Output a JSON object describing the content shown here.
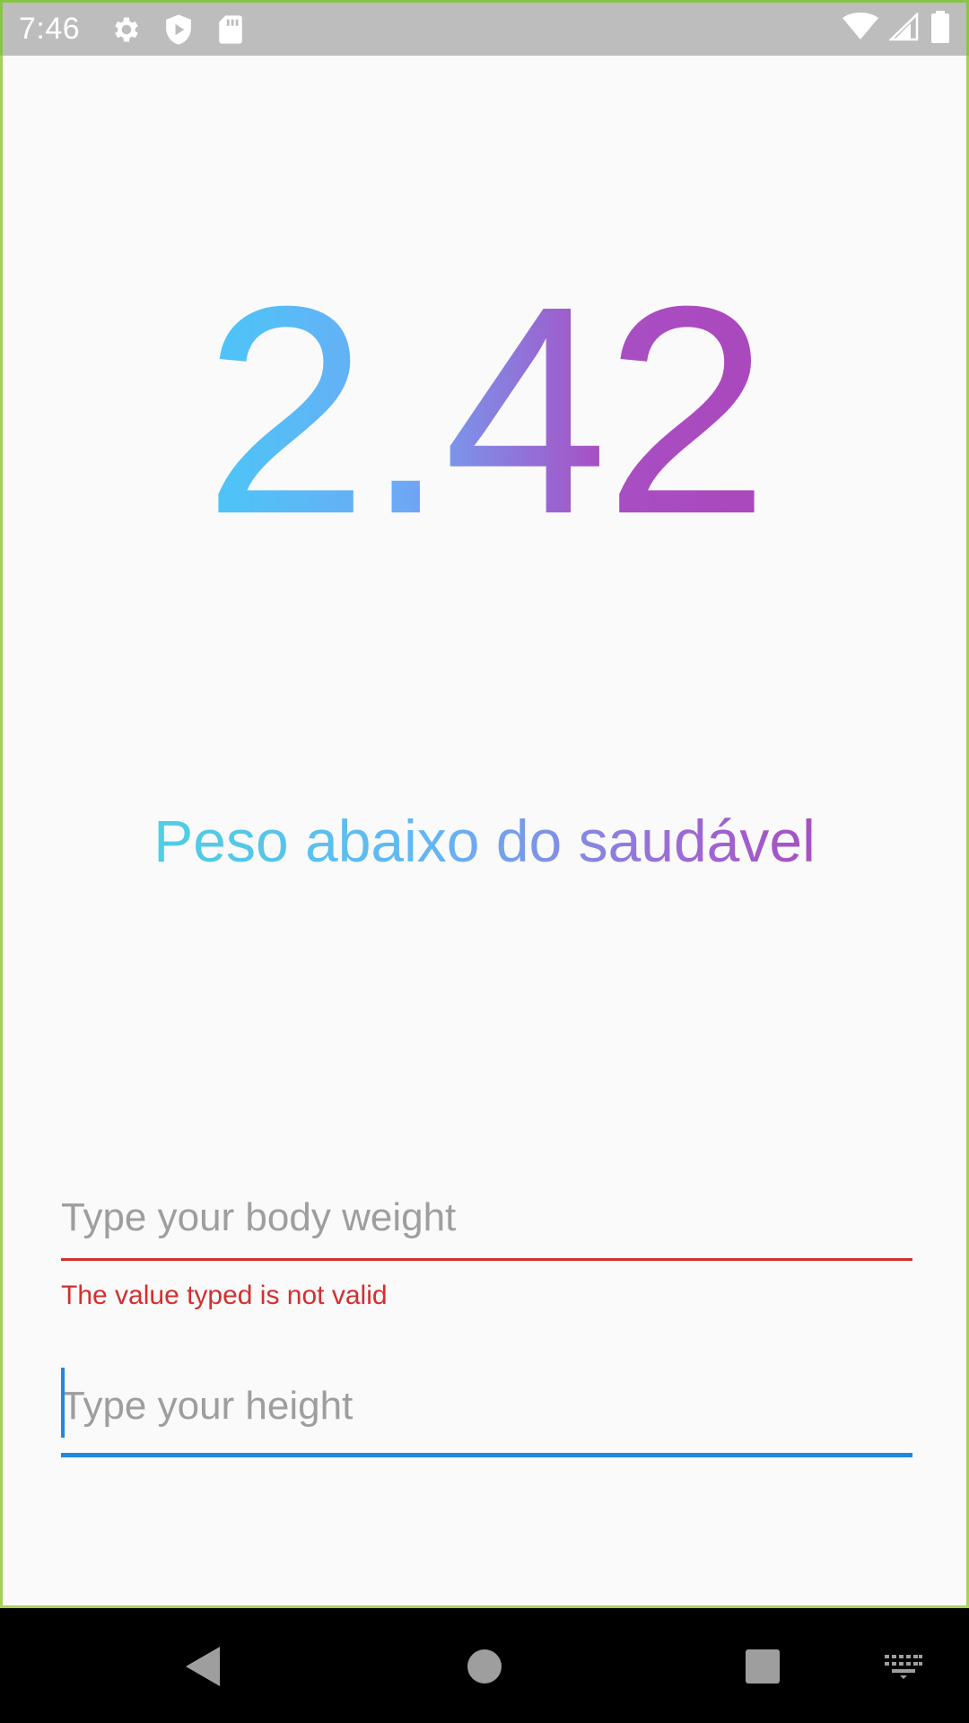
{
  "status_bar": {
    "time": "7:46",
    "icons_left": [
      "settings-icon",
      "shield-play-icon",
      "sd-card-icon"
    ],
    "icons_right": [
      "wifi-icon",
      "signal-icon",
      "battery-icon"
    ]
  },
  "result": {
    "bmi_value": "2.42",
    "classification": "Peso abaixo do saudável",
    "gradient_start": "#4fc3f7",
    "gradient_end": "#ab47bc"
  },
  "form": {
    "weight": {
      "value": "",
      "placeholder": "Type your body weight",
      "error": "The value typed is not valid"
    },
    "height": {
      "value": "",
      "placeholder": "Type your height"
    },
    "error_color": "#d32f2f",
    "focus_color": "#1e88e5"
  },
  "nav_bar": {
    "buttons": [
      "back-icon",
      "home-icon",
      "recents-icon",
      "keyboard-icon"
    ]
  }
}
